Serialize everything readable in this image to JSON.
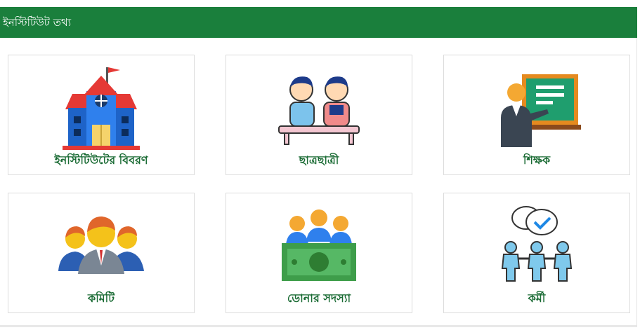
{
  "header": {
    "title": "ইনস্টিটিউট তথ্য"
  },
  "cards": [
    {
      "label": "ইনস্টিটিউটের বিবরণ",
      "icon": "school-building-icon"
    },
    {
      "label": "ছাত্রছাত্রী",
      "icon": "students-icon"
    },
    {
      "label": "শিক্ষক",
      "icon": "teacher-icon"
    },
    {
      "label": "কমিটি",
      "icon": "committee-icon"
    },
    {
      "label": "ডোনার সদস্যা",
      "icon": "donor-members-icon"
    },
    {
      "label": "কর্মী",
      "icon": "staff-icon"
    }
  ],
  "colors": {
    "header_bg": "#1a7f3c",
    "label_text": "#1a6b34"
  }
}
